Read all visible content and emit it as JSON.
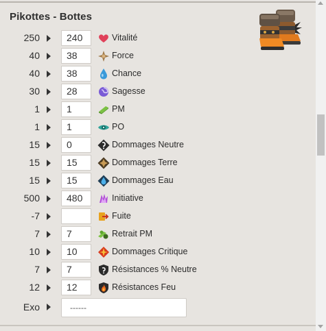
{
  "item": {
    "title": "Pikottes - Bottes",
    "image_name": "boots-item-image"
  },
  "stats": [
    {
      "base": "250",
      "value": "240",
      "label": "Vitalité",
      "icon": "heart-icon"
    },
    {
      "base": "40",
      "value": "38",
      "label": "Force",
      "icon": "force-icon"
    },
    {
      "base": "40",
      "value": "38",
      "label": "Chance",
      "icon": "water-drop-icon"
    },
    {
      "base": "30",
      "value": "28",
      "label": "Sagesse",
      "icon": "wisdom-icon"
    },
    {
      "base": "1",
      "value": "1",
      "label": "PM",
      "icon": "pm-icon"
    },
    {
      "base": "1",
      "value": "1",
      "label": "PO",
      "icon": "eye-icon"
    },
    {
      "base": "15",
      "value": "0",
      "label": "Dommages Neutre",
      "icon": "neutral-damage-icon"
    },
    {
      "base": "15",
      "value": "15",
      "label": "Dommages Terre",
      "icon": "earth-damage-icon"
    },
    {
      "base": "15",
      "value": "15",
      "label": "Dommages Eau",
      "icon": "water-damage-icon"
    },
    {
      "base": "500",
      "value": "480",
      "label": "Initiative",
      "icon": "initiative-icon"
    },
    {
      "base": "-7",
      "value": "",
      "label": "Fuite",
      "icon": "flee-icon"
    },
    {
      "base": "7",
      "value": "7",
      "label": "Retrait PM",
      "icon": "mp-reduction-icon"
    },
    {
      "base": "10",
      "value": "10",
      "label": "Dommages Critique",
      "icon": "critical-damage-icon"
    },
    {
      "base": "7",
      "value": "7",
      "label": "Résistances % Neutre",
      "icon": "neutral-resistance-icon"
    },
    {
      "base": "12",
      "value": "12",
      "label": "Résistances Feu",
      "icon": "fire-resistance-icon"
    }
  ],
  "exo": {
    "label": "Exo",
    "value": "------"
  },
  "colors": {
    "panel_bg": "#e7e4e0",
    "heart": "#e0415a",
    "water": "#3a9ad9",
    "earth": "#8a6d3b",
    "fire": "#e8661e",
    "neutral": "#2b2b2b",
    "wisdom": "#7a5bd6",
    "pm_green": "#7cc243",
    "initiative": "#b24fd8"
  }
}
